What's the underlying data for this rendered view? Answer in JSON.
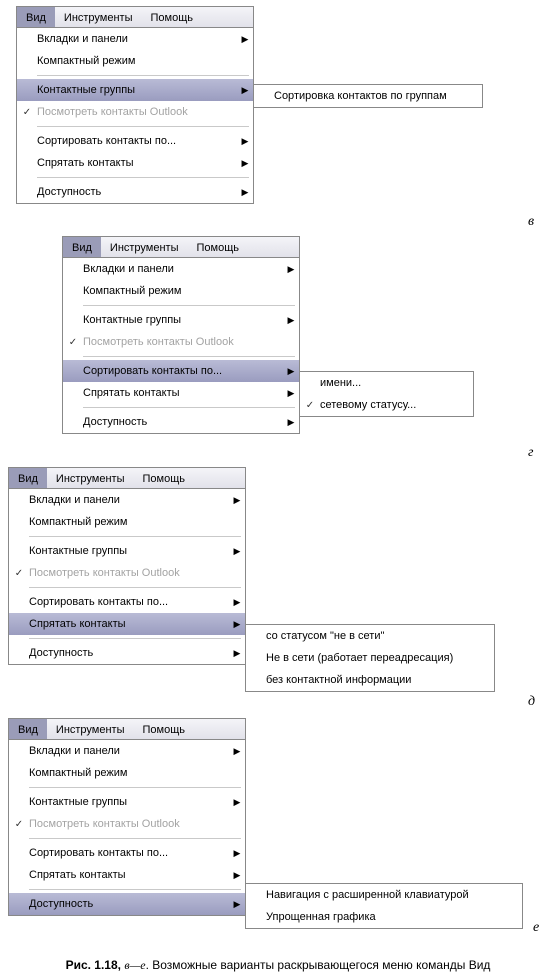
{
  "menubar": {
    "view": "Вид",
    "tools": "Инструменты",
    "help": "Помощь"
  },
  "menu": {
    "tabs_panels": "Вкладки и панели",
    "compact_mode": "Компактный режим",
    "contact_groups": "Контактные группы",
    "view_outlook_contacts": "Посмотреть контакты Outlook",
    "sort_contacts_by": "Сортировать контакты по...",
    "hide_contacts": "Спрятать контакты",
    "accessibility": "Доступность"
  },
  "sub_v": {
    "sort_by_groups": "Сортировка контактов по группам"
  },
  "sub_g": {
    "by_name": "имени...",
    "by_status": "сетевому статусу..."
  },
  "sub_d": {
    "offline_status": "со статусом \"не в сети\"",
    "offline_forwarding": "Не в сети (работает переадресация)",
    "no_contact_info": "без контактной информации"
  },
  "sub_e": {
    "ext_keyboard_nav": "Навигация с расширенной клавиатурой",
    "simple_graphics": "Упрощенная графика"
  },
  "letters": {
    "v": "в",
    "g": "г",
    "d": "д",
    "e": "е"
  },
  "caption": {
    "fig": "Рис. 1.18,",
    "range": "в—е",
    "text": ". Возможные варианты раскрывающегося меню команды Вид"
  }
}
